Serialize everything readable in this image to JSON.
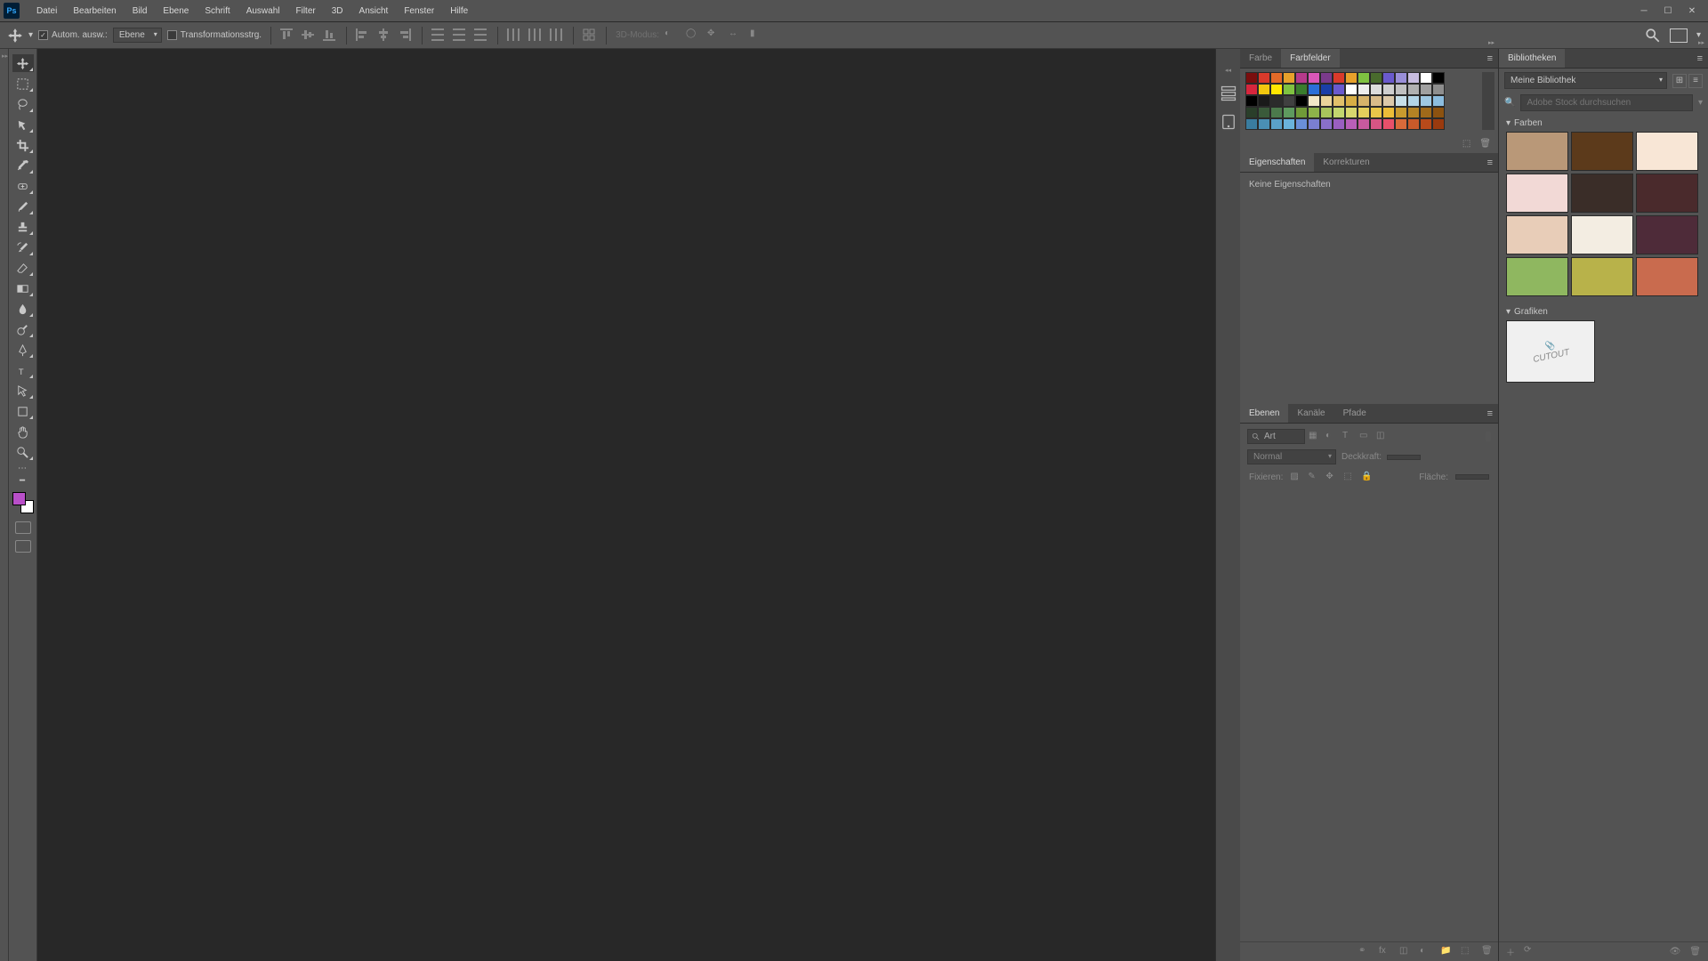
{
  "app": {
    "logo_text": "Ps"
  },
  "menu": {
    "file": "Datei",
    "edit": "Bearbeiten",
    "image": "Bild",
    "layer": "Ebene",
    "type": "Schrift",
    "select": "Auswahl",
    "filter": "Filter",
    "3d": "3D",
    "view": "Ansicht",
    "window": "Fenster",
    "help": "Hilfe"
  },
  "options": {
    "auto_select": "Autom. ausw.:",
    "auto_select_checked": true,
    "layer_dd": "Ebene",
    "transform_ctrls": "Transformationsstrg.",
    "transform_checked": false,
    "mode3d": "3D-Modus:"
  },
  "panels": {
    "color_tab": "Farbe",
    "swatches_tab": "Farbfelder",
    "properties_tab": "Eigenschaften",
    "adjustments_tab": "Korrekturen",
    "no_properties": "Keine Eigenschaften",
    "layers_tab": "Ebenen",
    "channels_tab": "Kanäle",
    "paths_tab": "Pfade",
    "libraries_tab": "Bibliotheken"
  },
  "layers": {
    "filter_kind": "Art",
    "blend_mode": "Normal",
    "opacity_label": "Deckkraft:",
    "lock_label": "Fixieren:",
    "fill_label": "Fläche:"
  },
  "libraries": {
    "selected": "Meine Bibliothek",
    "search_placeholder": "Adobe Stock durchsuchen",
    "colors_section": "Farben",
    "graphics_section": "Grafiken",
    "graphic_text": "CUTOUT",
    "colors": [
      "#b99878",
      "#5c3a1b",
      "#f8e6d6",
      "#f2d9d6",
      "#3a2d28",
      "#4a2a2c",
      "#e8cdb8",
      "#f3ede2",
      "#4e2b39",
      "#8fb760",
      "#b8b24a",
      "#c96b4e"
    ]
  },
  "chart_data": {
    "type": "table",
    "description": "Swatch palette grid rows (approximate RGB hex per cell)",
    "swatch_rows": [
      [
        "#7a0e0e",
        "#d93a2b",
        "#e46a28",
        "#e7a12b",
        "#b63a8b",
        "#d957b8",
        "#7a3a8b",
        "#d93a2b",
        "#e7a12b",
        "#7fc241",
        "#496b2d",
        "#6a5acd",
        "#9a8fd8",
        "#c8bde0",
        "#ffffff",
        "#000000"
      ],
      [
        "#d7263d",
        "#f2c80f",
        "#ffe600",
        "#7fc241",
        "#3a7d2d",
        "#2a6fd8",
        "#1a3fa8",
        "#6a5acd",
        "#ffffff",
        "#ededed",
        "#dcdcdc",
        "#cfcfcf",
        "#c0c0c0",
        "#b0b0b0",
        "#a0a0a0",
        "#8e8e8e"
      ],
      [
        "#000000",
        "#1a1a1a",
        "#2b2b2b",
        "#404040",
        "#000000",
        "#f2e7c7",
        "#e9d49a",
        "#e0c06a",
        "#d7ae45",
        "#d6b36a",
        "#d8bb8a",
        "#dcc9aa",
        "#c7dfe9",
        "#b3d4e6",
        "#9fc8e2",
        "#8cbddf"
      ],
      [
        "#2a3e2a",
        "#3a5a3a",
        "#4c7a4c",
        "#5e9a5e",
        "#709a38",
        "#8eb24a",
        "#a8c45c",
        "#c2d66e",
        "#d8d86e",
        "#e4cf5c",
        "#e8c64a",
        "#ecbd38",
        "#c89a2e",
        "#b48224",
        "#a06a1a",
        "#8c5210"
      ],
      [
        "#3a7da0",
        "#4a8fb4",
        "#5aa1c8",
        "#6ab3dc",
        "#6a8fd8",
        "#7a7fd0",
        "#8a6fc8",
        "#9a5fc0",
        "#b85fb8",
        "#c85a9e",
        "#d85584",
        "#e8506a",
        "#d86a3a",
        "#c85a2a",
        "#b84a1a",
        "#9a3a0e"
      ]
    ]
  },
  "foreground_color": "#b94fc9"
}
